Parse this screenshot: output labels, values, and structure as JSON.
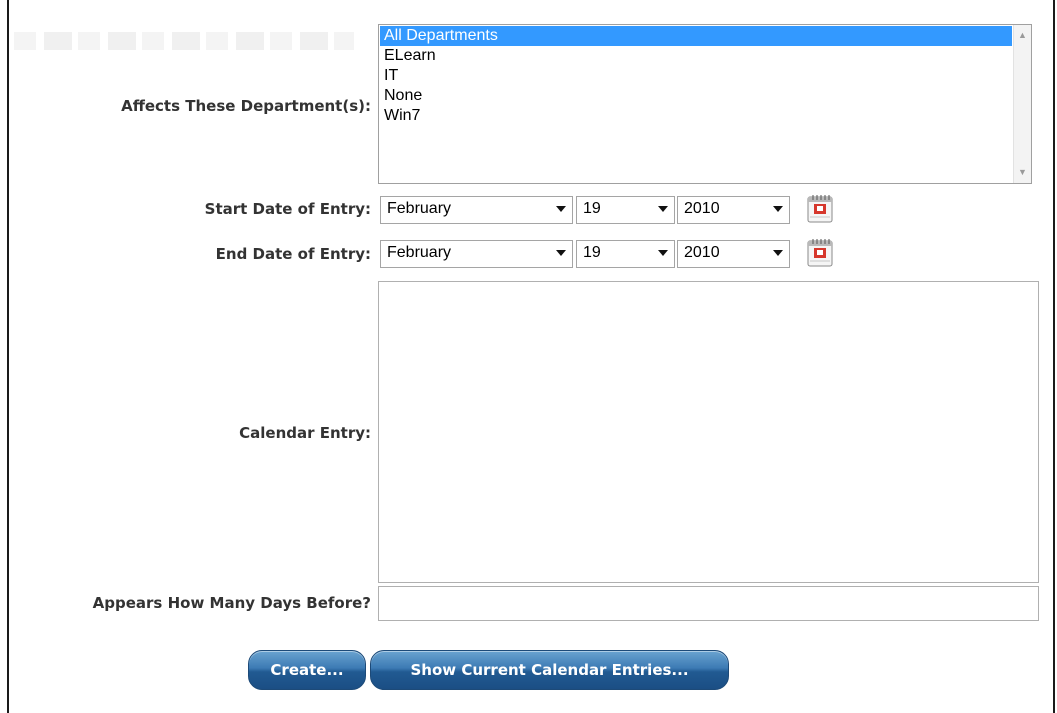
{
  "form": {
    "departments_label": "Affects These Department(s):",
    "departments": [
      {
        "label": "All Departments",
        "selected": true
      },
      {
        "label": "ELearn",
        "selected": false
      },
      {
        "label": "IT",
        "selected": false
      },
      {
        "label": "None",
        "selected": false
      },
      {
        "label": "Win7",
        "selected": false
      }
    ],
    "start_date": {
      "label": "Start Date of Entry:",
      "month": "February",
      "day": "19",
      "year": "2010"
    },
    "end_date": {
      "label": "End Date of Entry:",
      "month": "February",
      "day": "19",
      "year": "2010"
    },
    "calendar_entry": {
      "label": "Calendar Entry:",
      "value": ""
    },
    "days_before": {
      "label": "Appears How Many Days Before?",
      "value": ""
    }
  },
  "buttons": {
    "create": "Create...",
    "show_entries": "Show Current Calendar Entries..."
  },
  "colors": {
    "selection": "#3399ff",
    "button_top": "#6aa3d0",
    "button_bottom": "#1b4e84",
    "calendar_icon_red": "#d6372c"
  },
  "icons": {
    "calendar": "calendar-icon",
    "dropdown": "chevron-down-icon",
    "scroll_up": "scroll-up-arrow-icon",
    "scroll_down": "scroll-down-arrow-icon"
  }
}
